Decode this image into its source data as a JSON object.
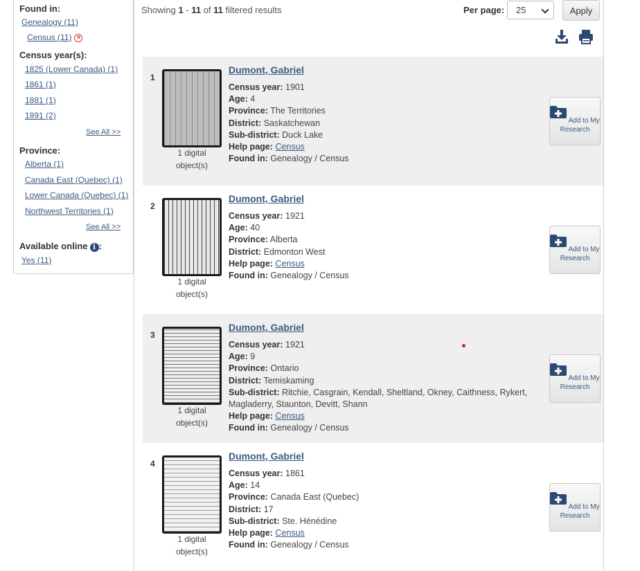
{
  "facets": {
    "found_in": {
      "title": "Found in:",
      "items": [
        {
          "label": "Genealogy (11)"
        },
        {
          "label": "Census (11)"
        }
      ]
    },
    "census_year": {
      "title": "Census year(s):",
      "items": [
        {
          "label": "1825 (Lower Canada) (1)"
        },
        {
          "label": "1861 (1)"
        },
        {
          "label": "1881 (1)"
        },
        {
          "label": "1891 (2)"
        }
      ],
      "see_all": "See All >>"
    },
    "province": {
      "title": "Province:",
      "items": [
        {
          "label": "Alberta (1)"
        },
        {
          "label": "Canada East (Quebec) (1)"
        },
        {
          "label": "Lower Canada (Quebec) (1)"
        },
        {
          "label": "Northwest Territories (1)"
        }
      ],
      "see_all": "See All >>"
    },
    "available_online": {
      "title": "Available online",
      "items": [
        {
          "label": "Yes (11)"
        }
      ]
    }
  },
  "summary": {
    "prefix": "Showing",
    "start": "1",
    "sep": "-",
    "end": "11",
    "of": "of",
    "total": "11",
    "suffix": "filtered results"
  },
  "per_page": {
    "label": "Per page:",
    "value": "25",
    "apply": "Apply"
  },
  "tools": {
    "download_icon": "download-icon",
    "print_icon": "printer-icon"
  },
  "labels": {
    "census_year": "Census year:",
    "age": "Age:",
    "province": "Province:",
    "district": "District:",
    "sub_district": "Sub-district:",
    "help_page": "Help page:",
    "found_in": "Found in:",
    "digital_line1": "1 digital",
    "digital_line2": "object(s)",
    "add_line1": "Add to My",
    "add_line2": "Research"
  },
  "results": [
    {
      "num": "1",
      "name": "Dumont, Gabriel",
      "census_year": "1901",
      "age": "4",
      "province": "The Territories",
      "district": "Saskatchewan",
      "sub_district": "Duck Lake",
      "help_page": "Census",
      "found_in": "Genealogy / Census"
    },
    {
      "num": "2",
      "name": "Dumont, Gabriel",
      "census_year": "1921",
      "age": "40",
      "province": "Alberta",
      "district": "Edmonton West",
      "help_page": "Census",
      "found_in": "Genealogy / Census"
    },
    {
      "num": "3",
      "name": "Dumont, Gabriel",
      "census_year": "1921",
      "age": "9",
      "province": "Ontario",
      "district": "Temiskaming",
      "sub_district": "Ritchie, Casgrain, Kendall, Sheltland, Okney, Caithness, Rykert, Magladerry, Staunton, Devitt, Shann",
      "help_page": "Census",
      "found_in": "Genealogy / Census"
    },
    {
      "num": "4",
      "name": "Dumont, Gabriel",
      "census_year": "1861",
      "age": "14",
      "province": "Canada East (Quebec)",
      "district": "17",
      "sub_district": "Ste. Hénédine",
      "help_page": "Census",
      "found_in": "Genealogy / Census"
    }
  ]
}
